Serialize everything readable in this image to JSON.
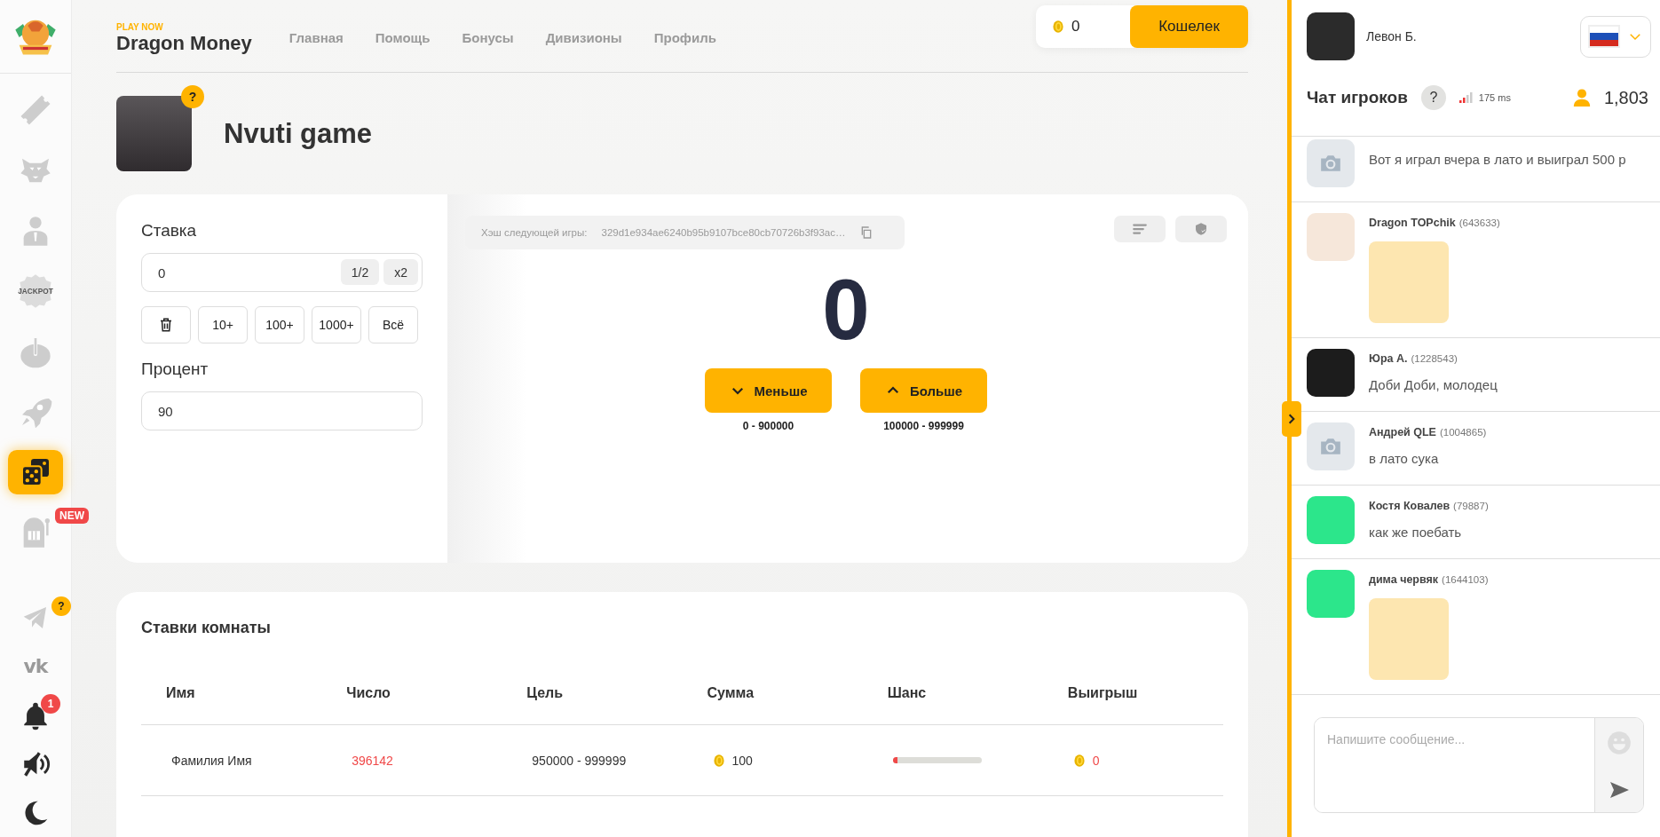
{
  "sidebar": {
    "items": [
      {
        "selected": false
      },
      {
        "selected": false
      },
      {
        "selected": false
      },
      {
        "selected": false,
        "label": "JACKPOT"
      },
      {
        "selected": false
      },
      {
        "selected": false
      },
      {
        "selected": true
      },
      {
        "selected": false,
        "badge": "NEW"
      }
    ],
    "telegram": {
      "badge": "?"
    },
    "vk": {
      "label": "vk"
    },
    "notifications": {
      "badge": "1"
    },
    "sound": {
      "muted": true
    }
  },
  "header": {
    "brand_tag": "PLAY NOW",
    "brand": "Dragon Money",
    "nav": [
      "Главная",
      "Помощь",
      "Бонусы",
      "Дивизионы",
      "Профиль"
    ],
    "balance": "0",
    "wallet_button": "Кошелек"
  },
  "game": {
    "title": "Nvuti game",
    "help_badge": "?",
    "bet": {
      "label": "Ставка",
      "value": "0",
      "half": "1/2",
      "double": "x2",
      "quick": [
        "10+",
        "100+",
        "1000+",
        "Всё"
      ]
    },
    "percent": {
      "label": "Процент",
      "value": "90"
    },
    "hash": {
      "label": "Хэш следующей игры:",
      "value": "329d1e934ae6240b95b9107bce80cb70726b3f93ac…"
    },
    "result": "0",
    "actions": [
      {
        "kind": "down",
        "label": "Меньше",
        "range": "0 - 900000"
      },
      {
        "kind": "up",
        "label": "Больше",
        "range": "100000 - 999999"
      }
    ]
  },
  "bets": {
    "title": "Ставки комнаты",
    "columns": [
      "Имя",
      "Число",
      "Цель",
      "Сумма",
      "Шанс",
      "Выигрыш"
    ],
    "rows": [
      {
        "name": "Фамилия Имя",
        "number": "396142",
        "target": "950000 - 999999",
        "amount": "100",
        "chance": {
          "level": 0.05
        },
        "win": "0",
        "won": false
      }
    ]
  },
  "chat": {
    "user": {
      "name": "Левон Б.",
      "avatar": {
        "kind": "picture",
        "color": "#2b2b2b"
      }
    },
    "title": "Чат игроков",
    "help_badge": "?",
    "ping": "175 ms",
    "online": "1,803",
    "messages": [
      {
        "kind": "text",
        "avatar": {
          "kind": "camera"
        },
        "text": "Вот я играл вчера в лато и выиграл 500 р"
      },
      {
        "kind": "sticker",
        "avatar": {
          "kind": "picture",
          "color": "#f6e7da"
        },
        "name": "Dragon TOPchik",
        "id": "(643633)"
      },
      {
        "kind": "text",
        "avatar": {
          "kind": "picture",
          "color": "#1c1c1c"
        },
        "name": "Юра А.",
        "id": "(1228543)",
        "text": "Доби Доби, молодец"
      },
      {
        "kind": "text",
        "avatar": {
          "kind": "camera"
        },
        "name": "Андрей QLE",
        "id": "(1004865)",
        "text": "в лато сука"
      },
      {
        "kind": "text",
        "avatar": {
          "kind": "picture",
          "color": "#2ce68b"
        },
        "name": "Костя Ковалев",
        "id": "(79887)",
        "text": "как же поебать"
      },
      {
        "kind": "sticker",
        "avatar": {
          "kind": "picture",
          "color": "#2ce68b"
        },
        "name": "дима червяк",
        "id": "(1644103)"
      }
    ],
    "input": {
      "placeholder": "Напишите сообщение..."
    }
  }
}
